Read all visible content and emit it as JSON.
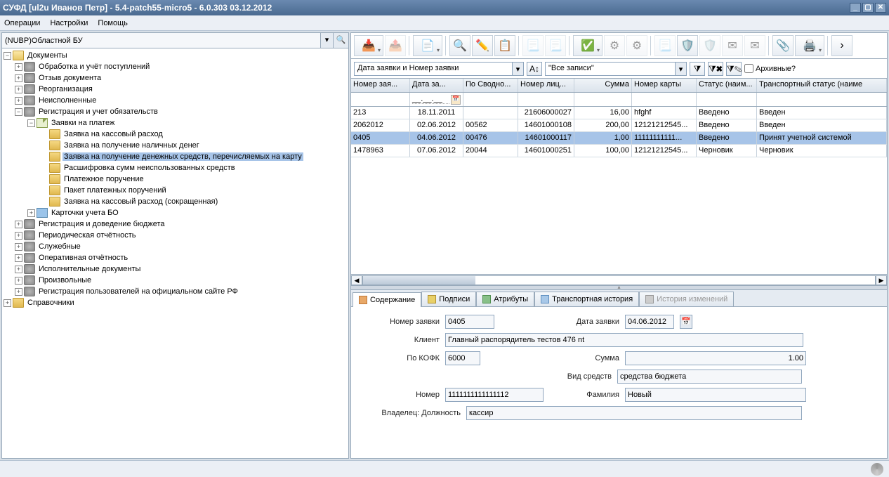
{
  "window": {
    "title": "СУФД [ul2u Иванов Петр] - 5.4-patch55-micro5 - 6.0.303 03.12.2012"
  },
  "menu": {
    "operations": "Операции",
    "settings": "Настройки",
    "help": "Помощь"
  },
  "org": {
    "value": "(NUBP)Областной БУ"
  },
  "tree": {
    "root": "Документы",
    "n_obrabotka": "Обработка и учёт поступлений",
    "n_otzyv": "Отзыв документа",
    "n_reorg": "Реорганизация",
    "n_neisp": "Неисполненные",
    "n_reg": "Регистрация и учет обязательств",
    "n_zayavki": "Заявки на платеж",
    "n_z_kass": "Заявка на кассовый расход",
    "n_z_nal": "Заявка на получение наличных денег",
    "n_z_karta": "Заявка на получение денежных средств, перечисляемых на карту",
    "n_rassh": "Расшифровка сумм неиспользованных средств",
    "n_plat": "Платежное поручение",
    "n_paket": "Пакет платежных поручений",
    "n_z_kass_s": "Заявка на кассовый расход (сокращенная)",
    "n_kartochki": "Карточки учета БО",
    "n_reg_budget": "Регистрация и доведение бюджета",
    "n_period": "Периодическая отчётность",
    "n_sluzh": "Служебные",
    "n_oper": "Оперативная отчётность",
    "n_ispol": "Исполнительные документы",
    "n_proizv": "Произвольные",
    "n_reg_polz": "Регистрация пользователей на официальном сайте РФ",
    "n_sprav": "Справочники"
  },
  "filter": {
    "sort_label": "Дата заявки и Номер заявки",
    "records_label": "\"Все записи\"",
    "archive_label": "Архивные?"
  },
  "table": {
    "headers": [
      "Номер зая...",
      "Дата за...",
      "По Сводно...",
      "Номер лиц...",
      "Сумма",
      "Номер карты",
      "Статус (наим...",
      "Транспортный статус (наиме"
    ],
    "rows": [
      {
        "num": "213",
        "date": "18.11.2011",
        "svod": "",
        "lic": "21606000027",
        "sum": "16,00",
        "card": "hfghf",
        "status": "Введено",
        "tstatus": "Введен"
      },
      {
        "num": "2062012",
        "date": "02.06.2012",
        "svod": "00562",
        "lic": "14601000108",
        "sum": "200,00",
        "card": "12121212545...",
        "status": "Введено",
        "tstatus": "Введен"
      },
      {
        "num": "0405",
        "date": "04.06.2012",
        "svod": "00476",
        "lic": "14601000117",
        "sum": "1,00",
        "card": "11111111111...",
        "status": "Введено",
        "tstatus": "Принят учетной системой",
        "selected": true
      },
      {
        "num": "1478963",
        "date": "07.06.2012",
        "svod": "20044",
        "lic": "14601000251",
        "sum": "100,00",
        "card": "12121212545...",
        "status": "Черновик",
        "tstatus": "Черновик"
      }
    ]
  },
  "tabs": {
    "t0": "Содержание",
    "t1": "Подписи",
    "t2": "Атрибуты",
    "t3": "Транспортная история",
    "t4": "История изменений"
  },
  "form": {
    "l_num": "Номер заявки",
    "v_num": "0405",
    "l_date": "Дата заявки",
    "v_date": "04.06.2012",
    "l_client": "Клиент",
    "v_client": "Главный распорядитель тестов 476 nt",
    "l_kofk": "По КОФК",
    "v_kofk": "6000",
    "l_sum": "Сумма",
    "v_sum": "1.00",
    "l_vid": "Вид средств",
    "v_vid": "средства бюджета",
    "l_cardnum": "Номер",
    "v_cardnum": "1111111111111112",
    "l_fam": "Фамилия",
    "v_fam": "Новый",
    "l_own": "Владелец: Должность",
    "v_own": "кассир"
  }
}
